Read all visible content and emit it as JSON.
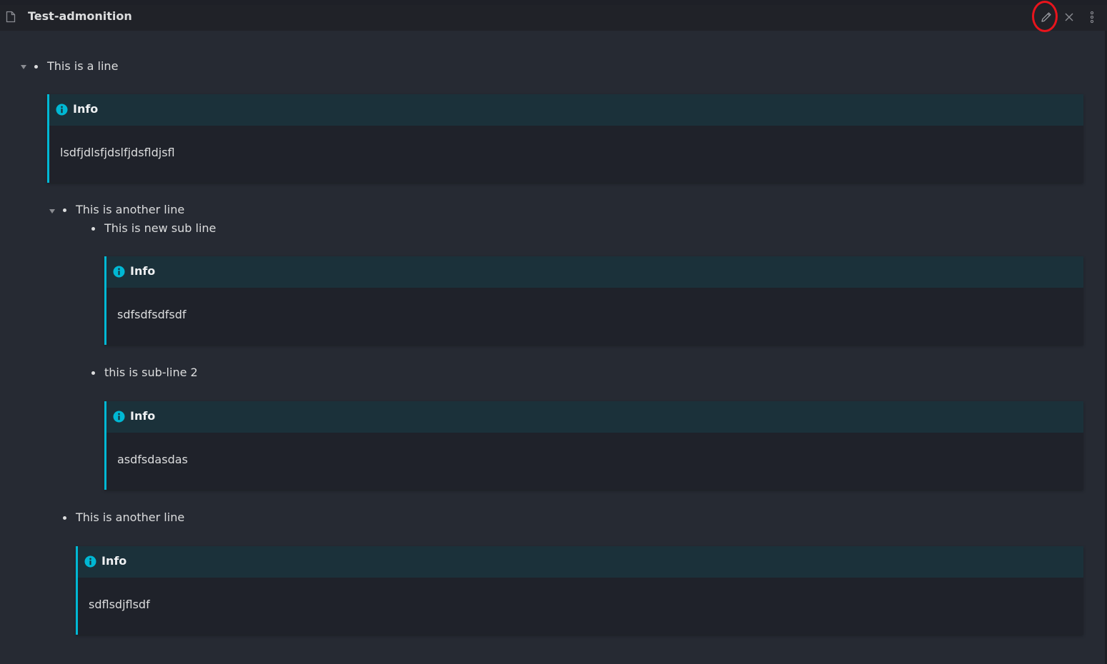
{
  "window": {
    "title": "Test-admonition"
  },
  "toolbar": {
    "edit_icon": "pencil-icon",
    "close_icon": "close-icon",
    "more_icon": "more-options-icon",
    "highlight_color": "#e8141c"
  },
  "colors": {
    "background": "#262a33",
    "admonition_accent": "#00b8d4",
    "admonition_header": "#1b313a",
    "admonition_body": "#1f222a"
  },
  "document": {
    "lines": [
      {
        "text": "This is a line"
      },
      {
        "text": "This is another line"
      },
      {
        "text": "This is new sub line"
      },
      {
        "text": "this is sub-line 2"
      },
      {
        "text": "This is another line"
      }
    ],
    "admonitions": [
      {
        "icon": "info-icon",
        "title": "Info",
        "body": "lsdfjdlsfjdslfjdsfldjsfl"
      },
      {
        "icon": "info-icon",
        "title": "Info",
        "body": "sdfsdfsdfsdf"
      },
      {
        "icon": "info-icon",
        "title": "Info",
        "body": "asdfsdasdas"
      },
      {
        "icon": "info-icon",
        "title": "Info",
        "body": "sdflsdjflsdf"
      }
    ]
  }
}
